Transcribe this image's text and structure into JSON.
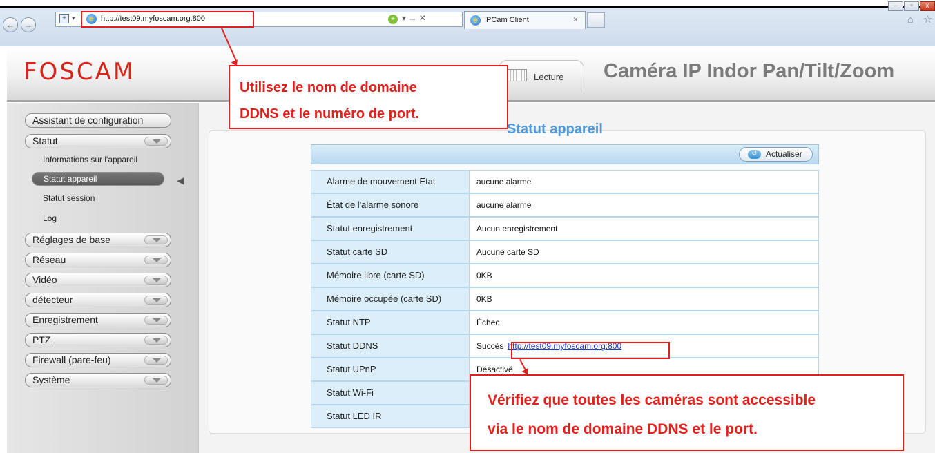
{
  "browser": {
    "url": "http://test09.myfoscam.org:800",
    "tab_title": "IPCam Client",
    "tab_close": "×",
    "tool_separators": "▾ → ✕"
  },
  "header": {
    "logo": "FOSCAM",
    "lecture_tab": "Lecture",
    "title": "Caméra IP Indor Pan/Tilt/Zoom"
  },
  "sidebar": {
    "setup_wizard": "Assistant de configuration",
    "statut": "Statut",
    "sub_info": "Informations sur l'appareil",
    "sub_active": "Statut appareil",
    "sub_session": "Statut session",
    "sub_log": "Log",
    "menus": [
      "Réglages de base",
      "Réseau",
      "Vidéo",
      "détecteur",
      "Enregistrement",
      "PTZ",
      "Firewall (pare-feu)",
      "Système"
    ]
  },
  "main": {
    "section_title": "Statut appareil",
    "refresh_label": "Actualiser",
    "rows": [
      {
        "label": "Alarme de mouvement Etat",
        "value": "aucune alarme"
      },
      {
        "label": "État de l'alarme sonore",
        "value": "aucune alarme"
      },
      {
        "label": "Statut enregistrement",
        "value": "Aucun enregistrement"
      },
      {
        "label": "Statut carte SD",
        "value": "Aucune carte SD"
      },
      {
        "label": "Mémoire libre (carte SD)",
        "value": "0KB"
      },
      {
        "label": "Mémoire occupée (carte SD)",
        "value": "0KB"
      },
      {
        "label": "Statut NTP",
        "value": "Échec"
      },
      {
        "label": "Statut DDNS",
        "value": "Succès",
        "link": "http://test09.myfoscam.org:800"
      },
      {
        "label": "Statut UPnP",
        "value": "Désactivé"
      },
      {
        "label": "Statut Wi-Fi",
        "value": ""
      },
      {
        "label": "Statut LED IR",
        "value": ""
      }
    ]
  },
  "callouts": {
    "top_line1": "Utilisez le nom de domaine",
    "top_line2": "DDNS et le numéro de port.",
    "bottom_line1": "Vérifiez que toutes les caméras sont accessible",
    "bottom_line2": "via le nom de domaine DDNS et le port."
  },
  "colors": {
    "accent_red": "#e3201b",
    "title_blue": "#4f9ad8",
    "logo_red": "#d9261c"
  }
}
